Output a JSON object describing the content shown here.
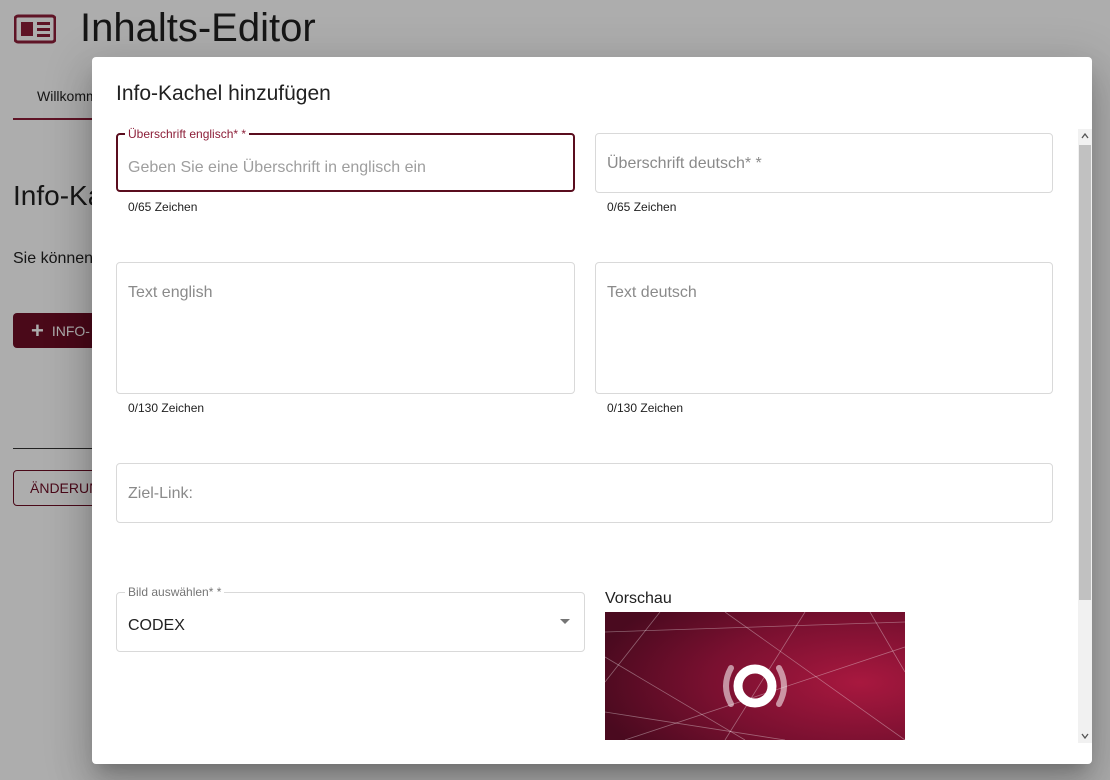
{
  "page": {
    "title": "Inhalts-Editor",
    "tab_label": "Willkomm",
    "section_title": "Info-Ka",
    "section_text": "Sie können",
    "add_button_label": "INFO-",
    "changes_button_label": "ÄNDERUN"
  },
  "dialog": {
    "title": "Info-Kachel hinzufügen",
    "fields": {
      "heading_en": {
        "label": "Überschrift englisch* *",
        "placeholder": "Geben Sie eine Überschrift in englisch ein",
        "hint": "0/65 Zeichen"
      },
      "heading_de": {
        "placeholder": "Überschrift deutsch* *",
        "hint": "0/65 Zeichen"
      },
      "text_en": {
        "placeholder": "Text english",
        "hint": "0/130 Zeichen"
      },
      "text_de": {
        "placeholder": "Text deutsch",
        "hint": "0/130 Zeichen"
      },
      "target_link": {
        "placeholder": "Ziel-Link:"
      },
      "image_select": {
        "label": "Bild auswählen* *",
        "value": "CODEX"
      }
    },
    "preview": {
      "label": "Vorschau"
    }
  },
  "colors": {
    "accent": "#8c1e38",
    "accent_dark": "#6e0e26",
    "focus_border": "#5a0d1e"
  },
  "icons": {
    "header": "newspaper-icon",
    "add": "plus-icon",
    "select": "chevron-down-icon",
    "preview": "broadcast-icon"
  }
}
